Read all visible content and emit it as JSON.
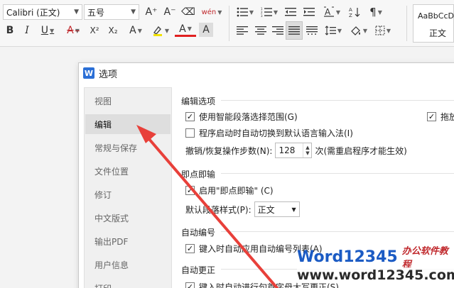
{
  "ribbon": {
    "font_name": "Calibri (正文)",
    "font_size": "五号",
    "style_preview_top": "AaBbCcD",
    "style_preview_name": "正文",
    "bold": "B",
    "italic": "I",
    "underline": "U",
    "strike": "A",
    "superscript": "X²",
    "subscript": "X₂",
    "text_effect": "A",
    "font_color": "A",
    "char_shade": "A",
    "grow_font": "A⁺",
    "shrink_font": "A⁻",
    "clear_format": "⌫",
    "phonetic": "wén",
    "icons": [
      "bold-icon",
      "italic-icon",
      "underline-icon",
      "strikethrough-icon",
      "superscript-icon",
      "subscript-icon",
      "text-effect-icon",
      "highlight-icon",
      "font-color-icon",
      "char-shade-icon",
      "bullets-icon",
      "numbering-icon",
      "indent-icon",
      "outdent-icon",
      "text-direction-icon",
      "sort-icon",
      "show-marks-icon",
      "align-left-icon",
      "align-center-icon",
      "align-right-icon",
      "justify-icon",
      "distribute-icon",
      "line-spacing-icon",
      "shading-icon",
      "border-icon"
    ]
  },
  "dialog": {
    "icon_letter": "W",
    "title": "选项",
    "nav": [
      "视图",
      "编辑",
      "常规与保存",
      "文件位置",
      "修订",
      "中文版式",
      "输出PDF",
      "用户信息",
      "打印"
    ],
    "active_nav_index": 1,
    "sections": {
      "edit_options": {
        "title": "编辑选项",
        "smart_select": {
          "label": "使用智能段落选择范围(G)",
          "checked": true
        },
        "drag_partial": {
          "label": "拖放",
          "checked": true
        },
        "auto_switch_ime": {
          "label": "程序启动时自动切换到默认语言输入法(I)",
          "checked": false
        },
        "undo_label": "撤销/恢复操作步数(N):",
        "undo_value": "128",
        "undo_note": "次(需重启程序才能生效)"
      },
      "click_and_type": {
        "title": "即点即输",
        "enable": {
          "label": "启用\"即点即输\" (C)",
          "checked": true
        },
        "default_style_label": "默认段落样式(P):",
        "default_style_value": "正文"
      },
      "auto_numbering": {
        "title": "自动编号",
        "auto_list": {
          "label": "键入时自动应用自动编号列表(A)",
          "checked": true
        }
      },
      "auto_correct": {
        "title": "自动更正",
        "auto_caps": {
          "label": "键入时自动进行句首字母大写更正(S)",
          "checked": true
        }
      }
    }
  },
  "watermark": {
    "logo": "Word12345",
    "tagline": "办公软件教程",
    "url": "www.word12345.com"
  },
  "colors": {
    "accent": "#2b6fd6",
    "arrow": "#e8403a",
    "watermark_blue": "#1b5bc4",
    "watermark_red": "#c0282c"
  }
}
